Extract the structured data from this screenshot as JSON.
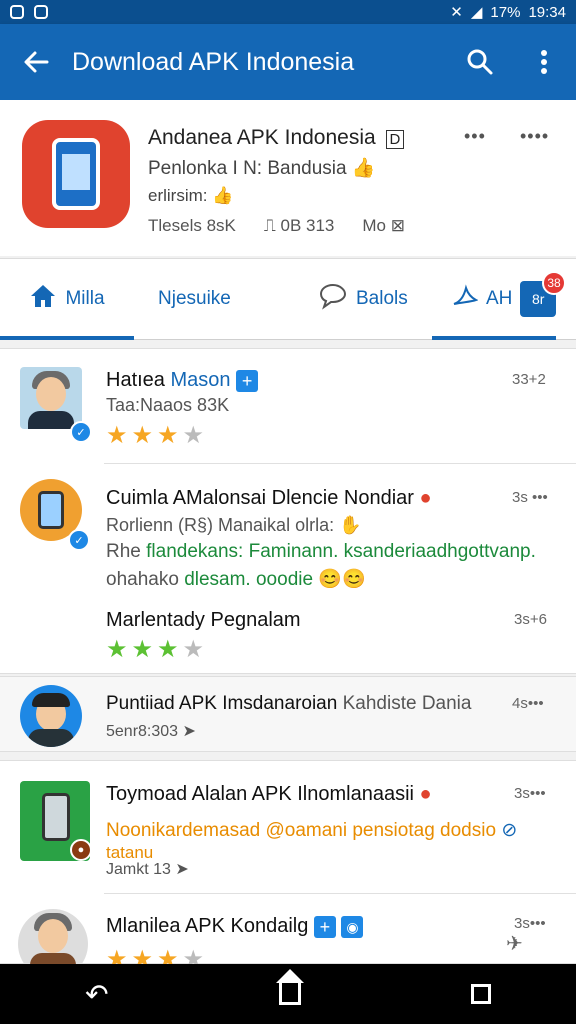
{
  "status_bar": {
    "time": "19:34",
    "battery": "17%"
  },
  "app_bar": {
    "title": "Download APK Indonesia",
    "back_icon": "arrow-left-icon",
    "search_icon": "search-icon",
    "menu_icon": "more-vert-icon"
  },
  "app_info": {
    "name": "Andanea APK Indonesia",
    "name_suffix": "D",
    "line1": "Penlonka I N: Bandusia",
    "line2": "erlirsim:",
    "stat1": "Tlesels 8sK",
    "stat2": "0B 313",
    "stat3": "Mo",
    "dots1": "•••",
    "dots2": "••••"
  },
  "tabs": [
    {
      "label": "Milla"
    },
    {
      "label": "Njesuike"
    },
    {
      "label": "Balols"
    },
    {
      "label": "AH",
      "badge_label": "8r",
      "notif": "38"
    }
  ],
  "reviews": [
    {
      "title_plain": "Hatıea ",
      "title_blue": "Mason",
      "subtitle": "Taa:Naaos 83K",
      "time": "33+2",
      "rating": 3,
      "max_rating": 4
    },
    {
      "title": "Cuimla AMalonsai Dlencie Nondiar",
      "subtitle": "Rorlienn (R§) Manaikal olrla:",
      "line3_plain": "Rhe ",
      "line3_green": "flandekans: Faminann. ksanderiaadhgottvanp.",
      "line4_plain": "ohahako ",
      "line4_green": "dlesam. ooodie",
      "time": "3s •••",
      "second_title": "Marlentady Pegnalam",
      "second_time": "3s+6",
      "rating": 3,
      "max_rating": 4
    },
    {
      "title_plain": "Puntiiad APK Imsdanaroian ",
      "title_gray": "Kahdiste Dania",
      "subtitle": "5enr8:303",
      "time": "4s•••"
    },
    {
      "title": "Toymoad Alalan APK Ilnomlanaasii",
      "line2": "Noonikardemasad @oamani pensiotag dodsio",
      "line3": "tatanu",
      "subtitle": "Jamkt 13",
      "time": "3s•••"
    },
    {
      "title": "Mlanilea APK Kondailg",
      "time": "3s•••"
    }
  ]
}
